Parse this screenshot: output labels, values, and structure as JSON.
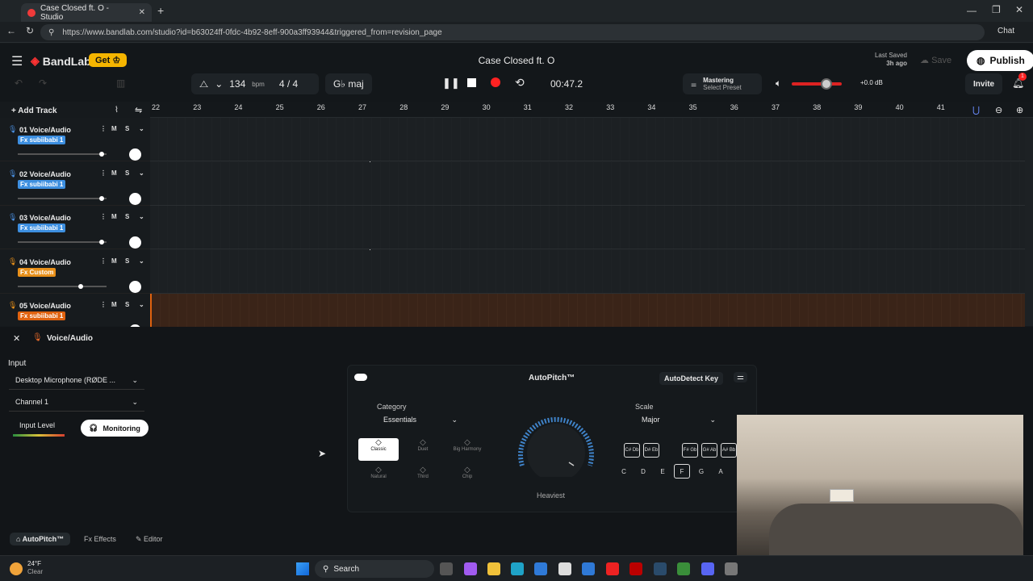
{
  "browser": {
    "tab_title": "Case Closed ft. O - Studio",
    "url": "https://www.bandlab.com/studio?id=b63024ff-0fdc-4b92-8eff-900a3ff93944&triggered_from=revision_page",
    "chat_label": "Chat"
  },
  "header": {
    "logo": "BandLab",
    "get_label": "Get",
    "song_title": "Case Closed ft. O",
    "last_saved": "Last Saved",
    "last_saved_when": "3h ago",
    "save_label": "Save",
    "publish_label": "Publish",
    "bpm": "134",
    "bpm_unit": "bpm",
    "time_sig": "4 / 4",
    "key": "G♭ maj",
    "time": "00:47.2",
    "mastering_title": "Mastering",
    "mastering_preset": "Select Preset",
    "volume_db": "+0.0 dB",
    "invite_label": "Invite",
    "notif_count": "1",
    "add_track_label": "Add Track"
  },
  "ruler": [
    "22",
    "23",
    "24",
    "25",
    "26",
    "27",
    "28",
    "29",
    "30",
    "31",
    "32",
    "33",
    "34",
    "35",
    "36",
    "37",
    "38",
    "39",
    "40",
    "41"
  ],
  "tracks": [
    {
      "name": "01  Voice/Audio",
      "fx": "Fx subiibabi 1",
      "fx_color": "#3d8fe0",
      "vol": 0.97
    },
    {
      "name": "02  Voice/Audio",
      "fx": "Fx subiibabi 1",
      "fx_color": "#3d8fe0",
      "vol": 0.97
    },
    {
      "name": "03  Voice/Audio",
      "fx": "Fx subiibabi 1",
      "fx_color": "#3d8fe0",
      "vol": 0.97
    },
    {
      "name": "04  Voice/Audio",
      "fx": "Fx Custom",
      "fx_color": "#e8901a",
      "vol": 0.72
    },
    {
      "name": "05  Voice/Audio",
      "fx": "Fx subiibabi 1",
      "fx_color": "#e0620f",
      "vol": 0.97
    }
  ],
  "panel": {
    "track_title": "Voice/Audio",
    "input_label": "Input",
    "input_device": "Desktop Microphone (RØDE ...",
    "channel": "Channel 1",
    "input_level_label": "Input Level",
    "monitoring_label": "Monitoring",
    "autopitch_title": "AutoPitch™",
    "autodetect_label": "AutoDetect Key",
    "category_label": "Category",
    "category_value": "Essentials",
    "scale_label": "Scale",
    "scale_value": "Major",
    "knob_label": "Heaviest",
    "modes": [
      "Classic",
      "Duet",
      "Big Harmony",
      "Natural",
      "Third",
      "Chip"
    ],
    "sharps": [
      "C#\nDb",
      "D#\nEb",
      "F#\nGb",
      "G#\nAb",
      "A#\nBb"
    ],
    "naturals": [
      "C",
      "D",
      "E",
      "F",
      "G",
      "A"
    ],
    "bottom_tabs": [
      "AutoPitch™",
      "Effects",
      "Editor"
    ]
  },
  "taskbar": {
    "temp": "24°F",
    "weather": "Clear",
    "search": "Search"
  }
}
